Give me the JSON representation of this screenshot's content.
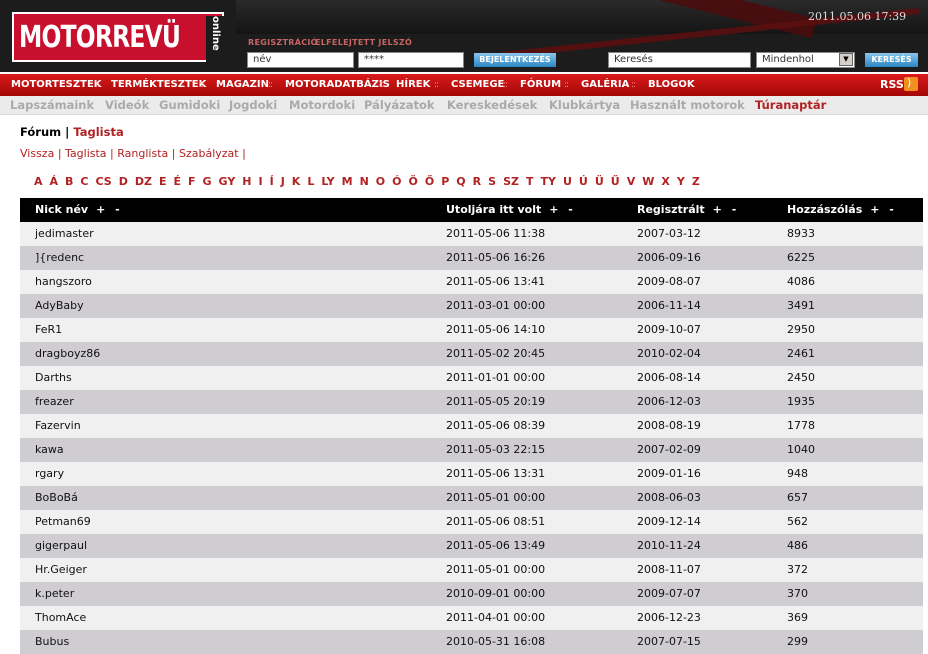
{
  "header": {
    "logo_text": "MOTORREVÜ",
    "logo_online": "online",
    "date_time": "2011.05.06  17:39",
    "register_label": "REGISZTRÁCIÓ",
    "forgot_password_label": "ELFELEJTETT JELSZÓ",
    "username_value": "név",
    "password_value": "****",
    "login_button": "BEJELENTKEZÉS",
    "search_value": "Keresés",
    "search_scope": "Mindenhol",
    "search_button": "KERESÉS"
  },
  "main_nav": [
    "MOTORTESZTEK",
    "TERMÉKTESZTEK",
    "MAGAZIN",
    "MOTORADATBÁZIS",
    "HÍREK",
    "CSEMEGE",
    "FÓRUM",
    "GALÉRIA",
    "BLOGOK"
  ],
  "rss_label": "RSS",
  "sub_nav": [
    {
      "label": "Lapszámaink",
      "active": false
    },
    {
      "label": "Videók",
      "active": false
    },
    {
      "label": "Gumidoki",
      "active": false
    },
    {
      "label": "Jogdoki",
      "active": false
    },
    {
      "label": "Motordoki",
      "active": false
    },
    {
      "label": "Pályázatok",
      "active": false
    },
    {
      "label": "Kereskedések",
      "active": false
    },
    {
      "label": "Klubkártya",
      "active": false
    },
    {
      "label": "Használt motorok",
      "active": false
    },
    {
      "label": "Túranaptár",
      "active": true
    }
  ],
  "breadcrumb": {
    "parent": "Fórum",
    "separator": "|",
    "current": "Taglista"
  },
  "page_links": [
    "Vissza",
    "Taglista",
    "Ranglista",
    "Szabályzat"
  ],
  "letters": [
    "A",
    "Á",
    "B",
    "C",
    "CS",
    "D",
    "DZ",
    "E",
    "É",
    "F",
    "G",
    "GY",
    "H",
    "I",
    "Í",
    "J",
    "K",
    "L",
    "LY",
    "M",
    "N",
    "O",
    "Ó",
    "Ö",
    "Ő",
    "P",
    "Q",
    "R",
    "S",
    "SZ",
    "T",
    "TY",
    "U",
    "Ú",
    "Ü",
    "Ű",
    "V",
    "W",
    "X",
    "Y",
    "Z"
  ],
  "table": {
    "headers": [
      {
        "label": "Nick név",
        "sort": "+ -"
      },
      {
        "label": "Utoljára itt volt",
        "sort": "+ -"
      },
      {
        "label": "Regisztrált",
        "sort": "+ -"
      },
      {
        "label": "Hozzászólás",
        "sort": "+ -"
      }
    ],
    "rows": [
      [
        "jedimaster",
        "2011-05-06 11:38",
        "2007-03-12",
        "8933"
      ],
      [
        "]{redenc",
        "2011-05-06 16:26",
        "2006-09-16",
        "6225"
      ],
      [
        "hangszoro",
        "2011-05-06 13:41",
        "2009-08-07",
        "4086"
      ],
      [
        "AdyBaby",
        "2011-03-01 00:00",
        "2006-11-14",
        "3491"
      ],
      [
        "FeR1",
        "2011-05-06 14:10",
        "2009-10-07",
        "2950"
      ],
      [
        "dragboyz86",
        "2011-05-02 20:45",
        "2010-02-04",
        "2461"
      ],
      [
        "Darths",
        "2011-01-01 00:00",
        "2006-08-14",
        "2450"
      ],
      [
        "freazer",
        "2011-05-05 20:19",
        "2006-12-03",
        "1935"
      ],
      [
        "Fazervin",
        "2011-05-06 08:39",
        "2008-08-19",
        "1778"
      ],
      [
        "kawa",
        "2011-05-03 22:15",
        "2007-02-09",
        "1040"
      ],
      [
        "rgary",
        "2011-05-06 13:31",
        "2009-01-16",
        "948"
      ],
      [
        "BoBoBá",
        "2011-05-01 00:00",
        "2008-06-03",
        "657"
      ],
      [
        "Petman69",
        "2011-05-06 08:51",
        "2009-12-14",
        "562"
      ],
      [
        "gigerpaul",
        "2011-05-06 13:49",
        "2010-11-24",
        "486"
      ],
      [
        "Hr.Geiger",
        "2011-05-01 00:00",
        "2008-11-07",
        "372"
      ],
      [
        "k.peter",
        "2010-09-01 00:00",
        "2009-07-07",
        "370"
      ],
      [
        "ThomAce",
        "2011-04-01 00:00",
        "2006-12-23",
        "369"
      ],
      [
        "Bubus",
        "2010-05-31 16:08",
        "2007-07-15",
        "299"
      ]
    ]
  },
  "colors": {
    "brand_red": "#c8102e",
    "nav_red": "#b80f0f",
    "link_red": "#b22222",
    "row_light": "#f0f0f0",
    "row_dark": "#cfcdd1"
  }
}
